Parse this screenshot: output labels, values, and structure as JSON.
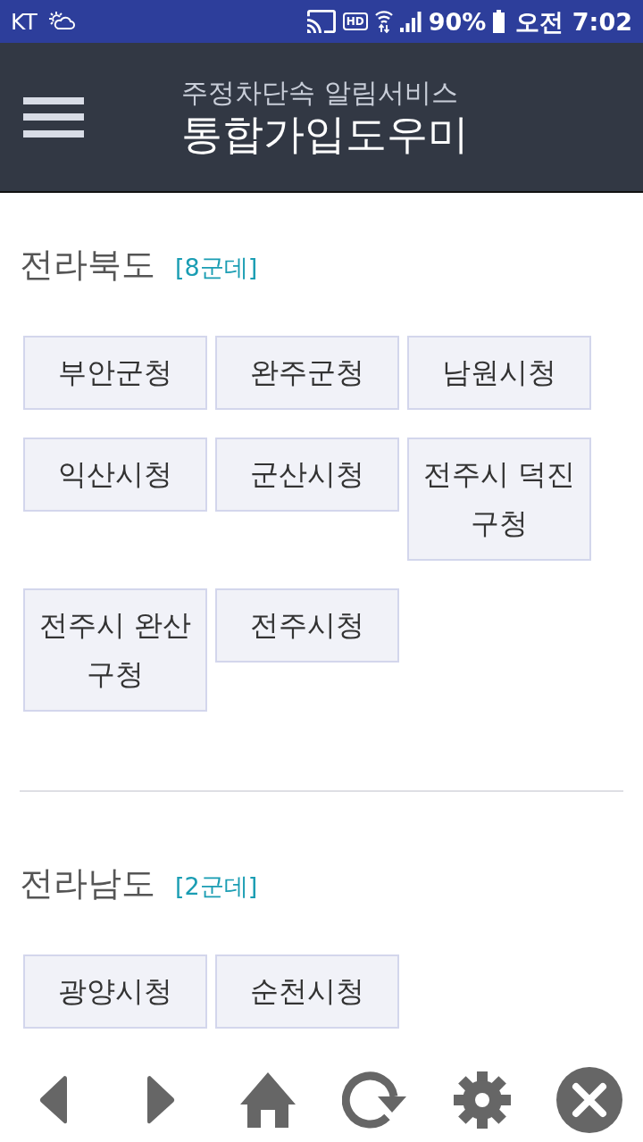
{
  "status_bar": {
    "carrier": "KT",
    "hd_badge": "HD",
    "battery": "90%",
    "time": "오전 7:02"
  },
  "header": {
    "subtitle": "주정차단속 알림서비스",
    "title": "통합가입도우미"
  },
  "sections": [
    {
      "region": "전라북도",
      "count": "[8군데]",
      "offices": [
        "부안군청",
        "완주군청",
        "남원시청",
        "익산시청",
        "군산시청",
        "전주시 덕진 구청",
        "전주시 완산 구청",
        "전주시청"
      ]
    },
    {
      "region": "전라남도",
      "count": "[2군데]",
      "offices": [
        "광양시청",
        "순천시청"
      ]
    }
  ]
}
